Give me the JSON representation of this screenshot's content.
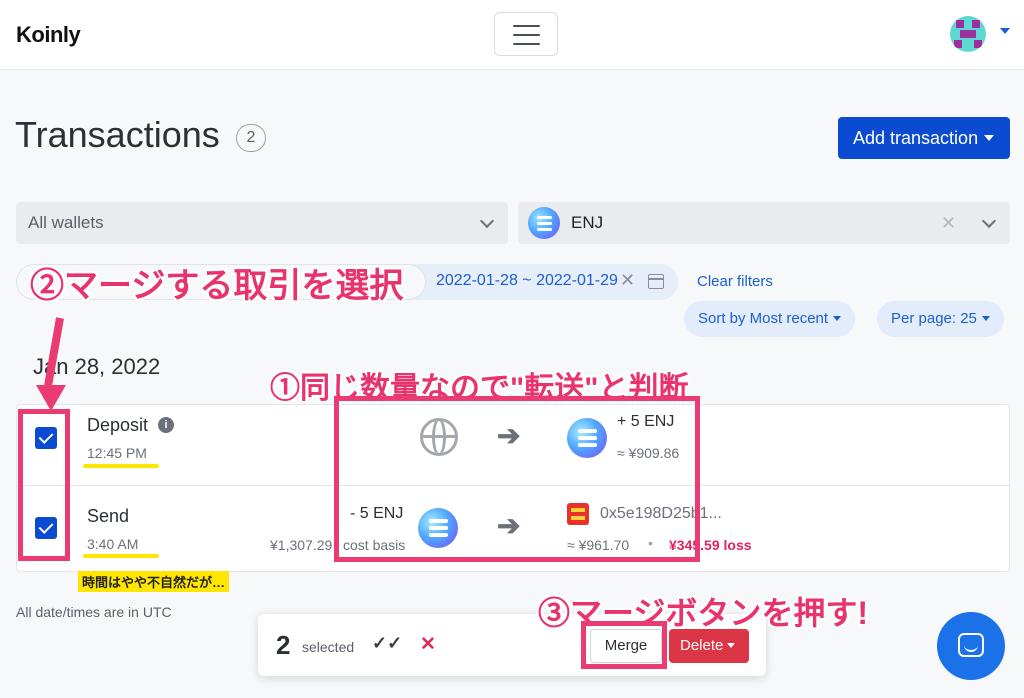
{
  "header": {
    "logo": "Koinly"
  },
  "page": {
    "title": "Transactions",
    "count": "2",
    "add_button": "Add transaction"
  },
  "filters": {
    "wallets": "All wallets",
    "coin": "ENJ",
    "date_range": "2022-01-28 ~ 2022-01-29",
    "clear": "Clear filters",
    "sort": "Sort by Most recent",
    "per_page": "Per page: 25"
  },
  "date_heading": "Jan 28, 2022",
  "transactions": [
    {
      "type": "Deposit",
      "time": "12:45 PM",
      "in_amount": "+ 5 ENJ",
      "in_value": "≈ ¥909.86"
    },
    {
      "type": "Send",
      "time": "3:40 AM",
      "cost_basis_value": "¥1,307.29",
      "cost_basis_label": "cost basis",
      "out_amount": "- 5 ENJ",
      "to_address": "0x5e198D25b1...",
      "out_value": "≈ ¥961.70",
      "loss": "¥345.59 loss"
    }
  ],
  "footnote": "All date/times are in UTC",
  "action_bar": {
    "count": "2",
    "selected_label": "selected",
    "merge": "Merge",
    "delete": "Delete"
  },
  "annotations": {
    "step1": "①同じ数量なので\"転送\"と判断",
    "step2": "②マージする取引を選択",
    "step3": "③マージボタンを押す!",
    "note": "時間はやや不自然だが…"
  },
  "colors": {
    "primary": "#0a4bd1",
    "danger": "#dc3545",
    "annotation": "#ea3b72",
    "highlight": "#ffe600"
  }
}
